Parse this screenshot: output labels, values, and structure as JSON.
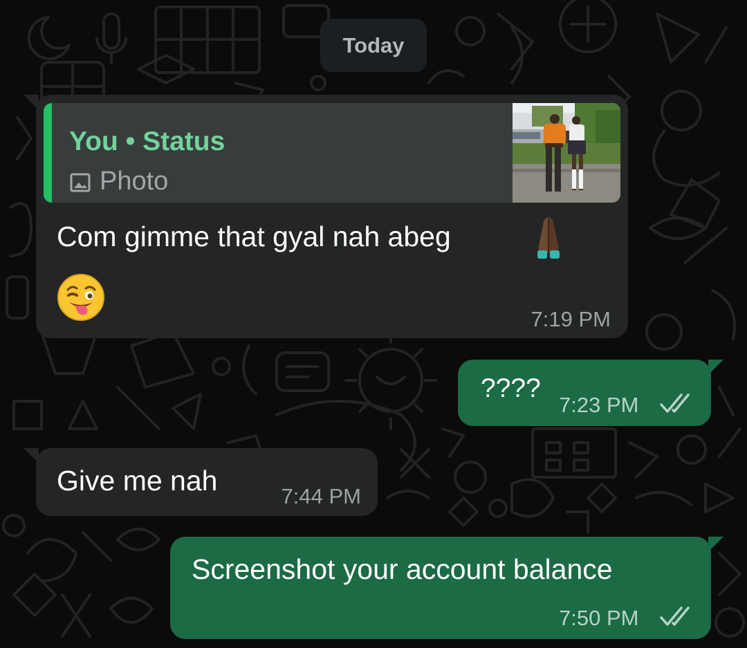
{
  "date_chip": "Today",
  "messages": [
    {
      "direction": "incoming",
      "reply_to": {
        "author": "You • Status",
        "type_label": "Photo",
        "type_icon": "image-icon"
      },
      "text": "Com gimme that gyal nah abeg",
      "emojis": [
        "folded-hands-emoji",
        "winking-tongue-emoji"
      ],
      "time": "7:19 PM"
    },
    {
      "direction": "outgoing",
      "text": "????",
      "time": "7:23 PM",
      "status": "read-double-check"
    },
    {
      "direction": "incoming",
      "text": "Give me nah",
      "time": "7:44 PM"
    },
    {
      "direction": "outgoing",
      "text": "Screenshot your account balance",
      "time": "7:50 PM",
      "status": "read-double-check"
    }
  ],
  "colors": {
    "background": "#0b0b0b",
    "incoming_bubble": "#242626",
    "outgoing_bubble": "#1b6b45",
    "quote_accent": "#21c063",
    "quote_author": "#71d39b"
  }
}
